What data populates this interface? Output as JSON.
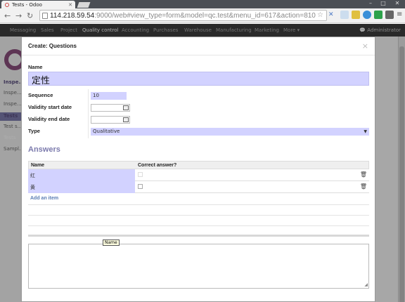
{
  "browser": {
    "tab_title": "Tests - Odoo",
    "url_host": "114.218.59.54",
    "url_rest": ":9000/web#view_type=form&model=qc.test&menu_id=617&action=810"
  },
  "app": {
    "menu": [
      "Messaging",
      "Sales",
      "Project",
      "Quality control",
      "Accounting",
      "Purchases",
      "Warehouse",
      "Manufacturing",
      "Marketing",
      "More ▾"
    ],
    "active_menu": "Quality control",
    "user": "Administrator",
    "sidebar": [
      "Inspe...",
      "Inspe...",
      "Inspe...",
      "Tests",
      "Test s...",
      "Tests",
      "Sampl..."
    ]
  },
  "modal": {
    "title": "Create: Questions",
    "close": "×",
    "labels": {
      "name": "Name",
      "sequence": "Sequence",
      "validity_start": "Validity start date",
      "validity_end": "Validity end date",
      "type": "Type"
    },
    "values": {
      "name": "定性",
      "sequence": "10",
      "type": "Qualitative"
    },
    "answers": {
      "title": "Answers",
      "columns": [
        "Name",
        "Correct answer?"
      ],
      "rows": [
        {
          "name": "红",
          "correct": false
        },
        {
          "name": "黄",
          "correct": false
        }
      ],
      "add_item": "Add an item"
    },
    "tooltip": "Name"
  },
  "colors": {
    "accent": "#7c7bad",
    "field_bg": "#d2d2ff"
  }
}
